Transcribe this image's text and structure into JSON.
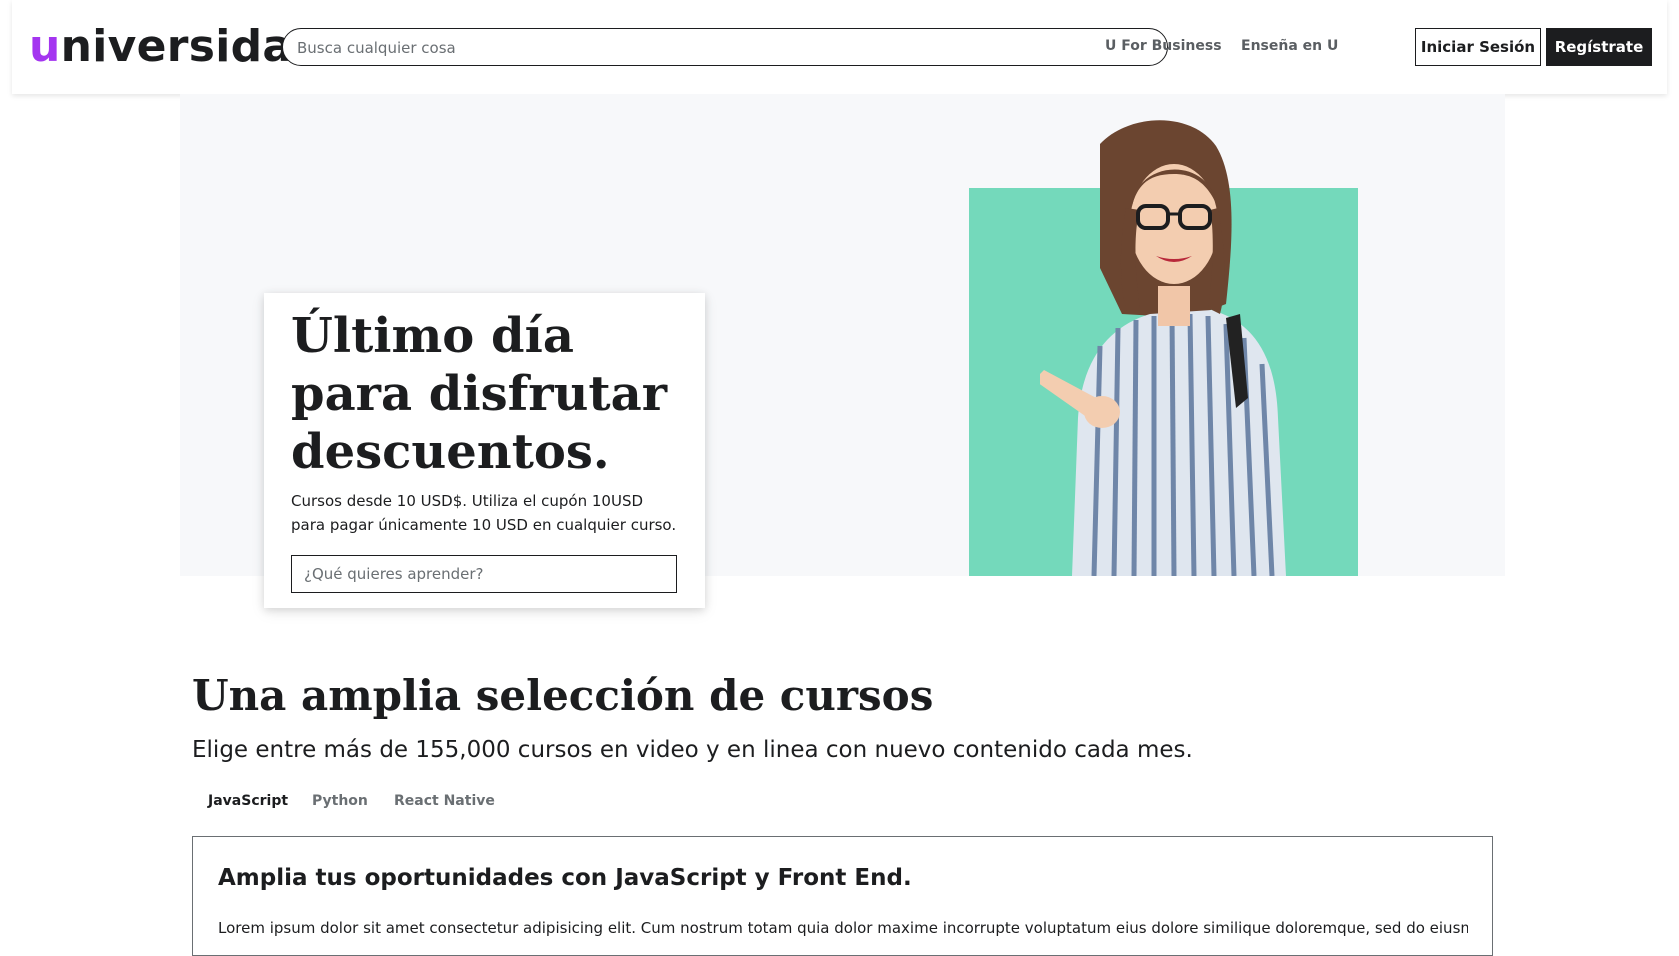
{
  "header": {
    "logo_first": "u",
    "logo_rest": "niversidad",
    "search_placeholder": "Busca cualquier cosa",
    "nav_business": "U For Business",
    "nav_teach": "Enseña en U",
    "login_label": "Iniciar Sesión",
    "register_label": "Regístrate"
  },
  "hero": {
    "title": "Último día para disfrutar descuentos.",
    "text": "Cursos desde 10 USD$. Utiliza el cupón 10USD para pagar únicamente 10 USD en cualquier curso.",
    "input_placeholder": "¿Qué quieres aprender?"
  },
  "courses": {
    "title": "Una amplia selección de cursos",
    "subtitle": "Elige entre más de 155,000 cursos en video y en linea con nuevo contenido cada mes.",
    "tabs": [
      {
        "label": "JavaScript",
        "active": true
      },
      {
        "label": "Python",
        "active": false
      },
      {
        "label": "React Native",
        "active": false
      }
    ],
    "box_title": "Amplia tus oportunidades con JavaScript y Front End.",
    "box_text": "Lorem ipsum dolor sit amet consectetur adipisicing elit. Cum nostrum totam quia dolor maxime incorrupte voluptatum eius dolore similique doloremque, sed do eiusmod tempor incididunt."
  },
  "colors": {
    "brand": "#a435f0",
    "text": "#1c1d1f",
    "hero_bg": "#f7f8fa",
    "hero_accent": "#74d9bb"
  }
}
